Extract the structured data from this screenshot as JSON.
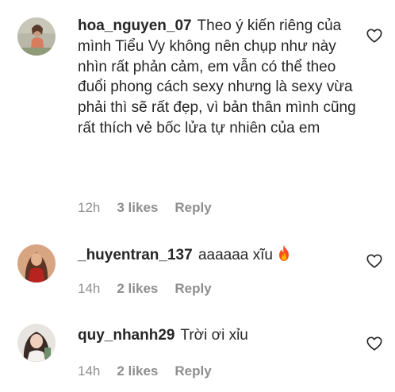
{
  "comments": [
    {
      "username": "hoa_nguyen_07",
      "text": "Theo ý kiến riêng của mình Tiểu Vy không nên chụp như này nhìn rất phản cảm, em vẫn có thể theo đuổi phong cách sexy nhưng là sexy vừa phải thì sẽ rất đẹp, vì bản thân mình cũng rất thích vẻ bốc lửa tự nhiên của em",
      "time": "12h",
      "likes": "3 likes",
      "reply": "Reply",
      "avatar_icon": "user-avatar-photo"
    },
    {
      "username": "_huyentran_137",
      "text": "aaaaaa xĩu",
      "emoji": "fire",
      "time": "14h",
      "likes": "2 likes",
      "reply": "Reply",
      "avatar_icon": "user-avatar-photo"
    },
    {
      "username": "quy_nhanh29",
      "text": "Trời ơi xỉu",
      "time": "14h",
      "likes": "2 likes",
      "reply": "Reply",
      "avatar_icon": "user-avatar-photo"
    }
  ],
  "icons": {
    "like": "heart-outline-icon"
  },
  "colors": {
    "text_primary": "#262626",
    "text_secondary": "#8e8e8e",
    "background": "#ffffff"
  }
}
